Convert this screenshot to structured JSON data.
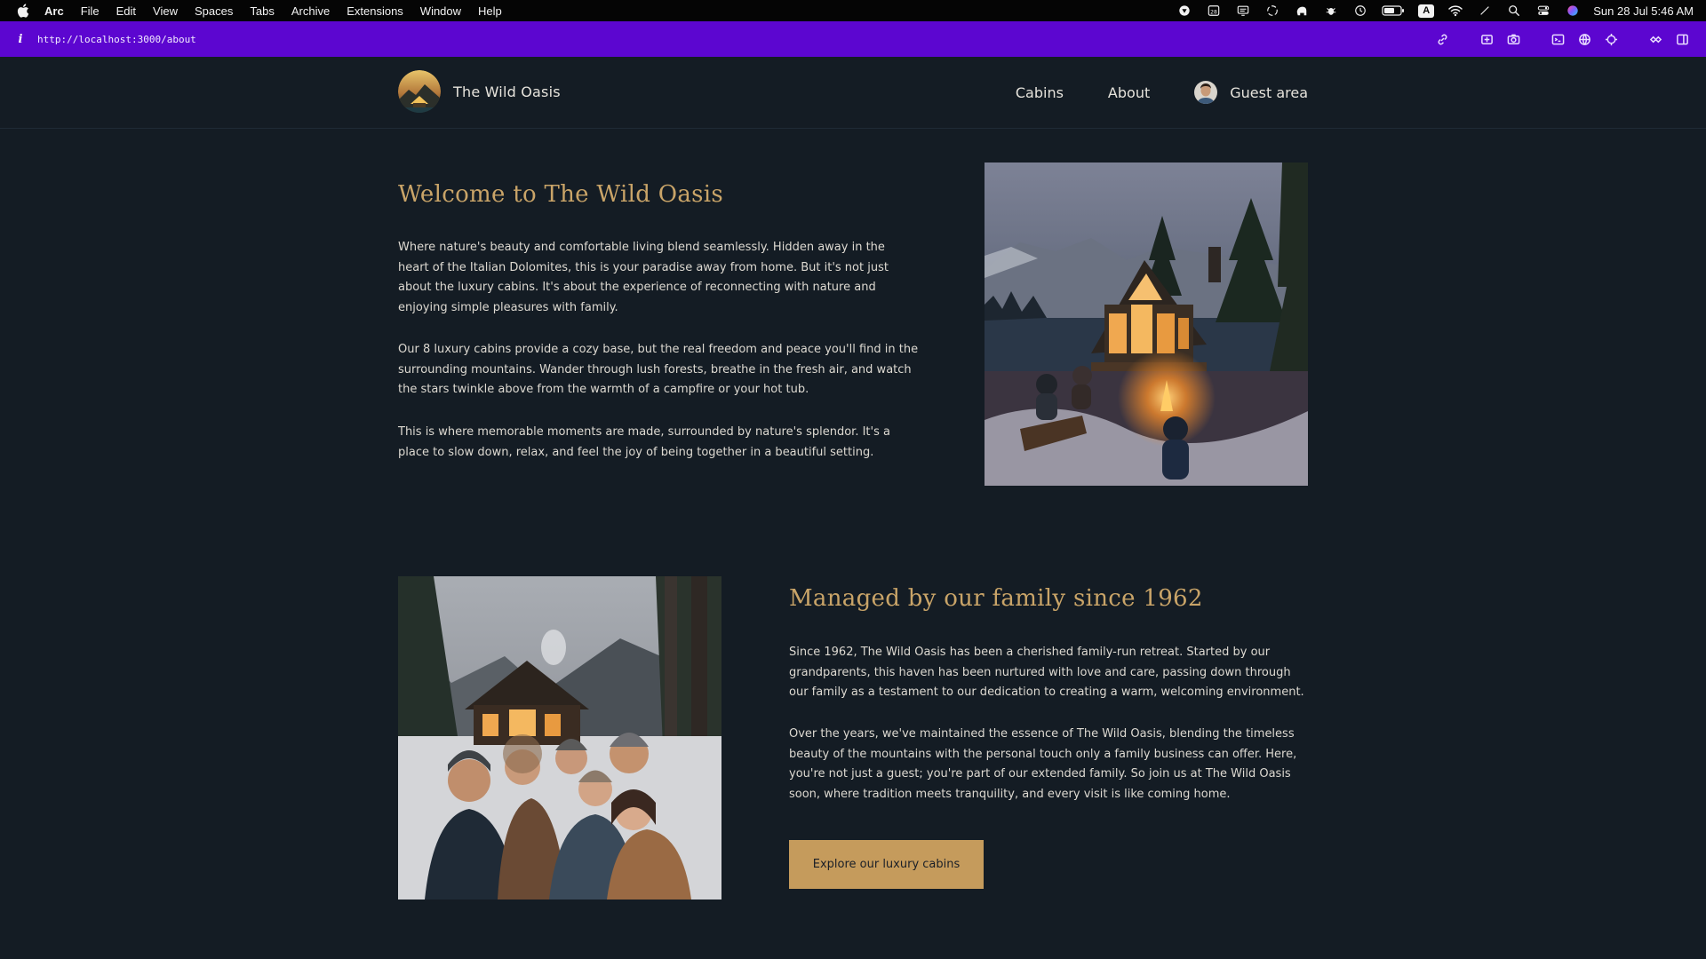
{
  "menubar": {
    "app_name": "Arc",
    "menus": [
      "File",
      "Edit",
      "View",
      "Spaces",
      "Tabs",
      "Archive",
      "Extensions",
      "Window",
      "Help"
    ],
    "calendar_day": "28",
    "keyboard_badge": "A",
    "clock": "Sun 28 Jul  5:46 AM"
  },
  "browser": {
    "url": "http://localhost:3000/about"
  },
  "site": {
    "brand": "The Wild Oasis",
    "nav": {
      "cabins": "Cabins",
      "about": "About",
      "guest": "Guest area"
    }
  },
  "welcome": {
    "title": "Welcome to The Wild Oasis",
    "paragraphs": [
      "Where nature's beauty and comfortable living blend seamlessly. Hidden away in the heart of the Italian Dolomites, this is your paradise away from home. But it's not just about the luxury cabins. It's about the experience of reconnecting with nature and enjoying simple pleasures with family.",
      "Our 8 luxury cabins provide a cozy base, but the real freedom and peace you'll find in the surrounding mountains. Wander through lush forests, breathe in the fresh air, and watch the stars twinkle above from the warmth of a campfire or your hot tub.",
      "This is where memorable moments are made, surrounded by nature's splendor. It's a place to slow down, relax, and feel the joy of being together in a beautiful setting."
    ]
  },
  "family": {
    "title": "Managed by our family since 1962",
    "paragraphs": [
      "Since 1962, The Wild Oasis has been a cherished family-run retreat. Started by our grandparents, this haven has been nurtured with love and care, passing down through our family as a testament to our dedication to creating a warm, welcoming environment.",
      "Over the years, we've maintained the essence of The Wild Oasis, blending the timeless beauty of the mountains with the personal touch only a family business can offer. Here, you're not just a guest; you're part of our extended family. So join us at The Wild Oasis soon, where tradition meets tranquility, and every visit is like coming home."
    ],
    "cta": "Explore our luxury cabins"
  },
  "colors": {
    "page_bg": "#141c24",
    "accent": "#c9a468",
    "button_bg": "#c59b5c",
    "urlbar_bg": "#5c06d0"
  }
}
